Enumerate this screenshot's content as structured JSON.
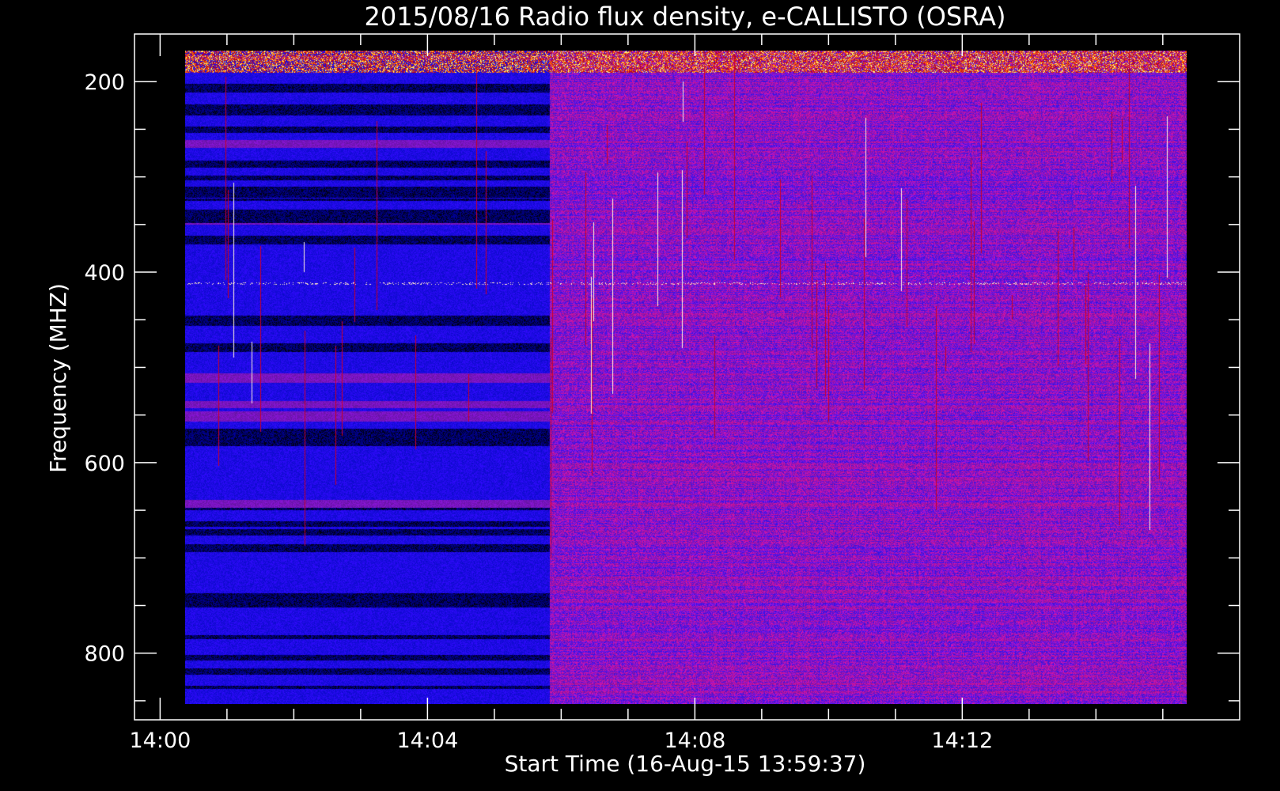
{
  "chart_data": {
    "type": "heatmap",
    "title": "2015/08/16  Radio flux density, e-CALLISTO (OSRA)",
    "xlabel": "Start Time (16-Aug-15 13:59:37)",
    "ylabel": "Frequency (MHZ)",
    "x_unit": "time (HH:MM)",
    "xlim": [
      "13:59:37",
      "14:16:09"
    ],
    "ylim": [
      150,
      870
    ],
    "y_inverted": true,
    "x_ticks": [
      "14:00",
      "14:04",
      "14:08",
      "14:12"
    ],
    "x_tick_values_min": [
      0,
      4,
      8,
      12
    ],
    "y_ticks": [
      "200",
      "400",
      "600",
      "800"
    ],
    "y_tick_values": [
      200,
      400,
      600,
      800
    ],
    "data_x_range": [
      "14:00:00",
      "14:15:00"
    ],
    "data_y_range": [
      150,
      865
    ],
    "colormap": [
      "#000000",
      "#0000ff",
      "#7a1a8a",
      "#c00000",
      "#ff7000",
      "#ffffff"
    ],
    "features": [
      {
        "label": "",
        "x_start": "14:00:00",
        "x_end": "14:05:50",
        "level": "blue background"
      },
      {
        "label": "",
        "x_start": "14:05:50",
        "x_end": "14:15:00",
        "level": "purple background"
      },
      {
        "label": "",
        "freq_mhz": 155,
        "note": "bright orange/white strip at top band"
      },
      {
        "label": "",
        "freq_mhz": 412,
        "note": "intermittent bright horizontal line"
      }
    ],
    "axis_color": "#ffffff",
    "background_color": "#000000",
    "grid": false
  }
}
